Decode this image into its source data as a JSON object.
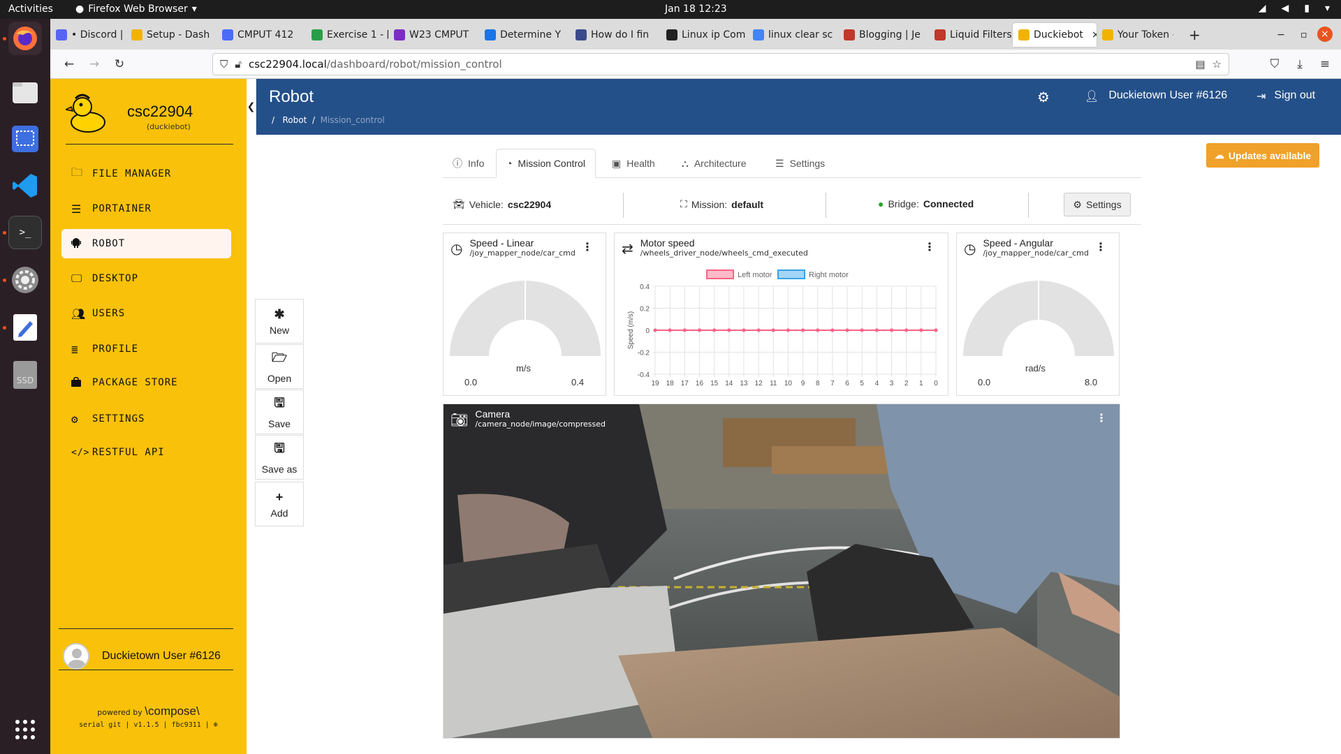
{
  "os": {
    "activities": "Activities",
    "app_name": "Firefox Web Browser",
    "clock": "Jan 18  12:23"
  },
  "browser": {
    "tabs": [
      {
        "label": "• Discord | #",
        "color": "#5865f2"
      },
      {
        "label": "Setup - Dash",
        "color": "#f0b400"
      },
      {
        "label": "CMPUT 412",
        "color": "#4a6cf7"
      },
      {
        "label": "Exercise 1 - [",
        "color": "#2a9d4a"
      },
      {
        "label": "W23 CMPUT",
        "color": "#7b2fbe"
      },
      {
        "label": "Determine Y",
        "color": "#1a73e8"
      },
      {
        "label": "How do I fin",
        "color": "#3b4a8c"
      },
      {
        "label": "Linux ip Com",
        "color": "#222222"
      },
      {
        "label": "linux clear sc",
        "color": "#4285f4"
      },
      {
        "label": "Blogging | Je",
        "color": "#c0392b"
      },
      {
        "label": "Liquid Filters",
        "color": "#c0392b"
      },
      {
        "label": "Duckiebot",
        "color": "#f0b400"
      },
      {
        "label": "Your Token -",
        "color": "#f0b400"
      }
    ],
    "url_host": "csc22904.local",
    "url_path": "/dashboard/robot/mission_control"
  },
  "sidebar": {
    "robot_name": "csc22904",
    "robot_type": "(duckiebot)",
    "items": [
      {
        "label": "FILE MANAGER",
        "icon": "folder-icon"
      },
      {
        "label": "PORTAINER",
        "icon": "sliders-icon"
      },
      {
        "label": "ROBOT",
        "icon": "android-icon"
      },
      {
        "label": "DESKTOP",
        "icon": "monitor-icon"
      },
      {
        "label": "USERS",
        "icon": "users-icon"
      },
      {
        "label": "PROFILE",
        "icon": "list-icon"
      },
      {
        "label": "PACKAGE STORE",
        "icon": "bag-icon"
      },
      {
        "label": "SETTINGS",
        "icon": "gear-icon"
      },
      {
        "label": "RESTFUL API",
        "icon": "code-icon"
      }
    ],
    "user_name": "Duckietown User #6126",
    "powered_by": "powered by",
    "compose": "\\compose\\",
    "version": "serial git | v1.1.5 | fbc9311 | ❄"
  },
  "header": {
    "title": "Robot",
    "crumb_root": "/",
    "crumb_1": "Robot",
    "crumb_sep": "/",
    "crumb_2": "Mission_control",
    "user": "Duckietown User #6126",
    "signout": "Sign out"
  },
  "updates_label": "Updates available",
  "page_tabs": [
    "Info",
    "Mission Control",
    "Health",
    "Architecture",
    "Settings"
  ],
  "status": {
    "vehicle_label": "Vehicle:",
    "vehicle": "csc22904",
    "mission_label": "Mission:",
    "mission": "default",
    "bridge_label": "Bridge:",
    "bridge": "Connected",
    "settings": "Settings"
  },
  "toolbar": [
    "New",
    "Open",
    "Save",
    "Save as",
    "Add"
  ],
  "widgets": {
    "linear": {
      "title": "Speed - Linear",
      "topic": "/joy_mapper_node/car_cmd",
      "unit": "m/s",
      "min": "0.0",
      "max": "0.4",
      "value": 0
    },
    "motor": {
      "title": "Motor speed",
      "topic": "/wheels_driver_node/wheels_cmd_executed"
    },
    "angular": {
      "title": "Speed - Angular",
      "topic": "/joy_mapper_node/car_cmd",
      "unit": "rad/s",
      "min": "0.0",
      "max": "8.0",
      "value": 0
    },
    "camera": {
      "title": "Camera",
      "topic": "/camera_node/image/compressed"
    }
  },
  "chart_data": {
    "type": "line",
    "title": "",
    "xlabel": "",
    "ylabel": "Speed (m/s)",
    "x": [
      19,
      18,
      17,
      16,
      15,
      14,
      13,
      12,
      11,
      10,
      9,
      8,
      7,
      6,
      5,
      4,
      3,
      2,
      1,
      0
    ],
    "ylim": [
      -0.4,
      0.4
    ],
    "yticks": [
      "0.4",
      "0.2",
      "0",
      "-0.2",
      "-0.4"
    ],
    "legend_position": "top",
    "series": [
      {
        "name": "Left motor",
        "color": "#ff6384",
        "values": [
          0,
          0,
          0,
          0,
          0,
          0,
          0,
          0,
          0,
          0,
          0,
          0,
          0,
          0,
          0,
          0,
          0,
          0,
          0,
          0
        ]
      },
      {
        "name": "Right motor",
        "color": "#36a2eb",
        "values": [
          0,
          0,
          0,
          0,
          0,
          0,
          0,
          0,
          0,
          0,
          0,
          0,
          0,
          0,
          0,
          0,
          0,
          0,
          0,
          0
        ]
      }
    ],
    "grid": true
  }
}
